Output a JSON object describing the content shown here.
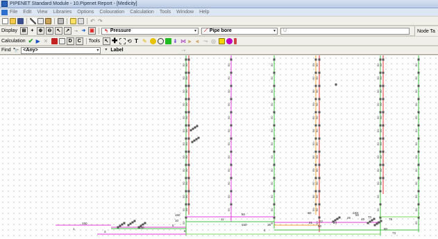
{
  "title_bar": {
    "title": "PIPENET Standard Module - 10.Pipenet Report - [Medicity]"
  },
  "menu": [
    "File",
    "Edit",
    "View",
    "Libraries",
    "Options",
    "Colouration",
    "Calculation",
    "Tools",
    "Window",
    "Help"
  ],
  "display_toolbar": {
    "label": "Display",
    "property1": "Pressure",
    "property2": "Pipe bore",
    "property3": "U",
    "node_tab": "Node Ta"
  },
  "calc_toolbar": {
    "calc_label": "Calculation",
    "d_btn": "D",
    "c_btn": "C",
    "tools_label": "Tools"
  },
  "find_toolbar": {
    "find_label": "Find",
    "find_value": "<Any>",
    "label_value": "Label"
  },
  "network": {
    "colors": {
      "pink": "#e03ad8",
      "green": "#3fbf3f",
      "orange": "#f0a030",
      "red": "#e03030",
      "lime": "#7ed957",
      "node": "#555555"
    },
    "bottom_labels": [
      {
        "t": "150"
      },
      {
        "t": "1"
      },
      {
        "t": "3"
      },
      {
        "t": "150"
      },
      {
        "t": "6"
      },
      {
        "t": "5"
      },
      {
        "t": "10"
      },
      {
        "t": "150"
      },
      {
        "t": "11"
      },
      {
        "t": "80"
      },
      {
        "t": "150"
      },
      {
        "t": "16"
      },
      {
        "t": "4"
      },
      {
        "t": "-50"
      },
      {
        "t": "21"
      },
      {
        "t": "22"
      },
      {
        "t": "50"
      },
      {
        "t": "24"
      },
      {
        "t": "-150"
      },
      {
        "t": "70"
      },
      {
        "t": "75"
      },
      {
        "t": "80"
      },
      {
        "t": "73"
      },
      {
        "t": "40"
      },
      {
        "t": "50"
      },
      {
        "t": "25"
      }
    ]
  }
}
